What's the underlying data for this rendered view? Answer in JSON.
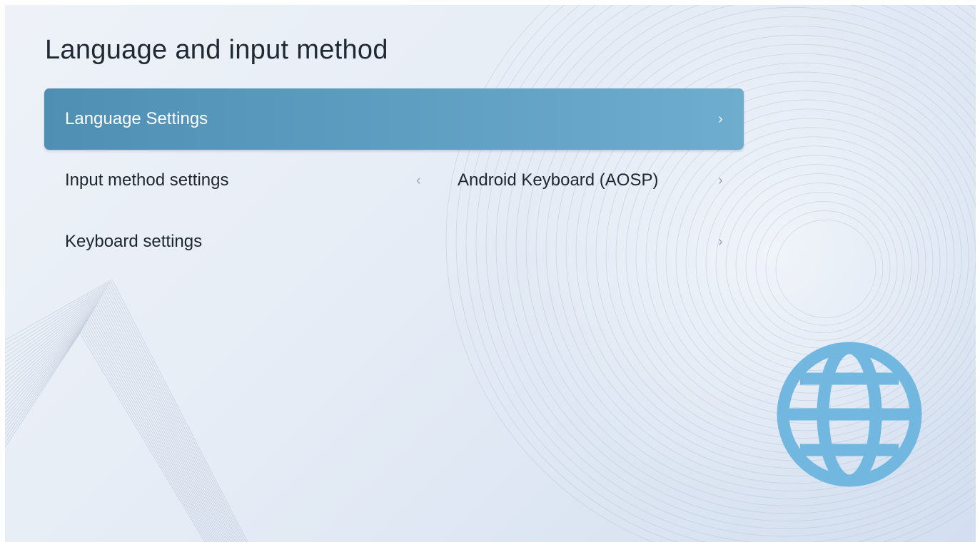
{
  "header": {
    "title": "Language and input method"
  },
  "menu": {
    "items": [
      {
        "label": "Language Settings",
        "value": "",
        "focused": true,
        "has_left_arrow": false
      },
      {
        "label": "Input method settings",
        "value": "Android Keyboard (AOSP)",
        "focused": false,
        "has_left_arrow": true
      },
      {
        "label": "Keyboard settings",
        "value": "",
        "focused": false,
        "has_left_arrow": false
      }
    ]
  },
  "icons": {
    "chevron_right": "chevron-right-icon",
    "chevron_left": "chevron-left-icon",
    "decoration": "globe-icon"
  },
  "colors": {
    "focus_highlight": "#5b9bc0",
    "globe": "#72b7df",
    "background": "#e6ecf5"
  }
}
